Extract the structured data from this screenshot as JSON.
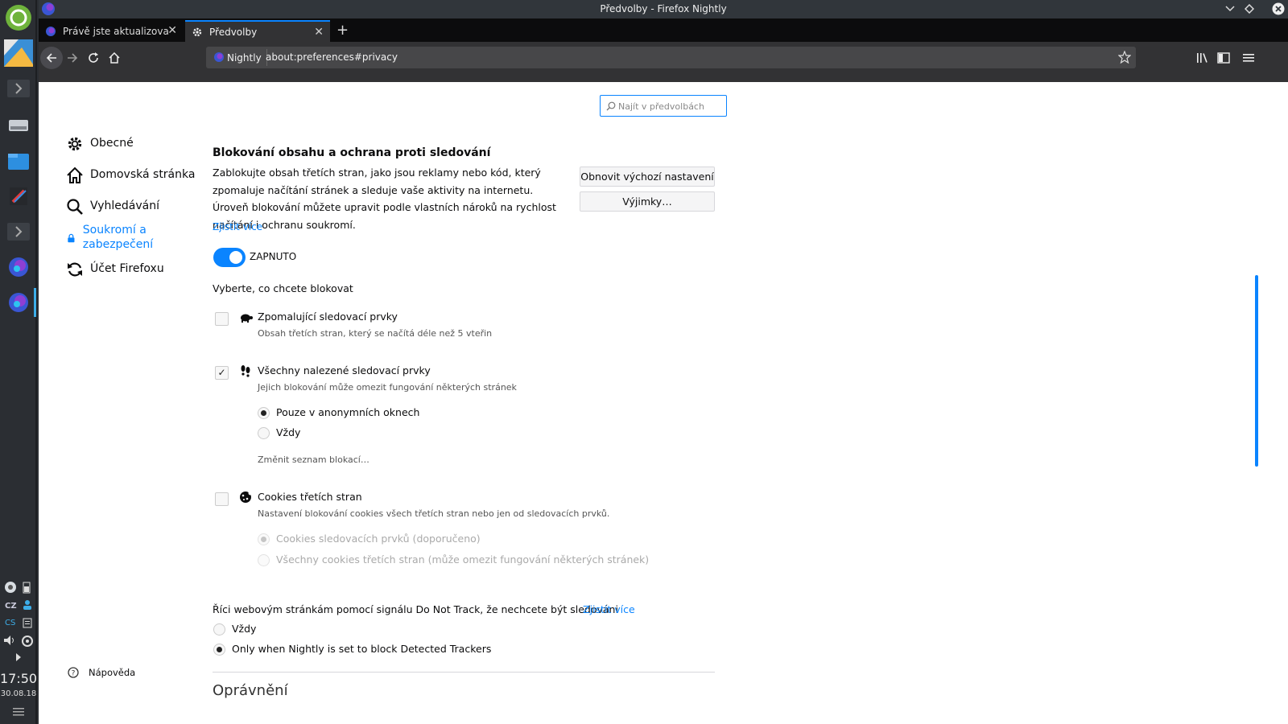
{
  "window": {
    "title": "Předvolby - Firefox Nightly"
  },
  "tabs": [
    {
      "label": "Právě jste aktualizovali Firefox",
      "active": false
    },
    {
      "label": "Předvolby",
      "active": true
    }
  ],
  "urlbar": {
    "identity": "Nightly",
    "url": "about:preferences#privacy"
  },
  "search": {
    "placeholder": "Najít v předvolbách"
  },
  "sidebar": {
    "items": [
      {
        "label": "Obecné",
        "icon": "gear-icon"
      },
      {
        "label": "Domovská stránka",
        "icon": "home-icon"
      },
      {
        "label": "Vyhledávání",
        "icon": "search-icon"
      },
      {
        "label": "Soukromí a zabezpečení",
        "icon": "lock-icon",
        "selected": true
      },
      {
        "label": "Účet Firefoxu",
        "icon": "sync-icon"
      }
    ],
    "help": "Nápověda"
  },
  "content_blocking": {
    "title": "Blokování obsahu a ochrana proti sledování",
    "description": "Zablokujte obsah třetích stran, jako jsou reklamy nebo kód, který zpomaluje načítání stránek a sleduje vaše aktivity na internetu. Úroveň blokování můžete upravit podle vlastních nároků na rychlost načítání i ochranu soukromí.",
    "learn_more": "Zjistit více",
    "restore_defaults": "Obnovit výchozí nastavení",
    "exceptions": "Výjimky…",
    "toggle_label": "ZAPNUTO",
    "choose_label": "Vyberte, co chcete blokovat",
    "slow_trackers": {
      "title": "Zpomalující sledovací prvky",
      "desc": "Obsah třetích stran, který se načítá déle než 5 vteřin",
      "checked": false
    },
    "all_trackers": {
      "title": "Všechny nalezené sledovací prvky",
      "desc": "Jejich blokování může omezit fungování některých stránek",
      "checked": true
    },
    "tracker_radio_private": "Pouze v anonymních oknech",
    "tracker_radio_always": "Vždy",
    "change_list": "Změnit seznam blokací…",
    "cookies": {
      "title": "Cookies třetích stran",
      "desc": "Nastavení blokování cookies všech třetích stran nebo jen od sledovacích prvků.",
      "checked": false
    },
    "cookies_radio_trackers": "Cookies sledovacích prvků (doporučeno)",
    "cookies_radio_all": "Všechny cookies třetích stran (může omezit fungování některých stránek)"
  },
  "dnt": {
    "label": "Říci webovým stránkám pomocí signálu Do Not Track, že nechcete být sledováni",
    "learn_more": "Zjistit více",
    "opt_always": "Vždy",
    "opt_only": "Only when Nightly is set to block Detected Trackers"
  },
  "permissions": {
    "title": "Oprávnění"
  },
  "taskbar": {
    "lang1": "CZ",
    "lang2": "CS",
    "time": "17:50",
    "date": "30.08.18"
  },
  "colors": {
    "accent": "#0a84ff",
    "chrome": "#323234",
    "tabbar": "#0c0c0d"
  }
}
